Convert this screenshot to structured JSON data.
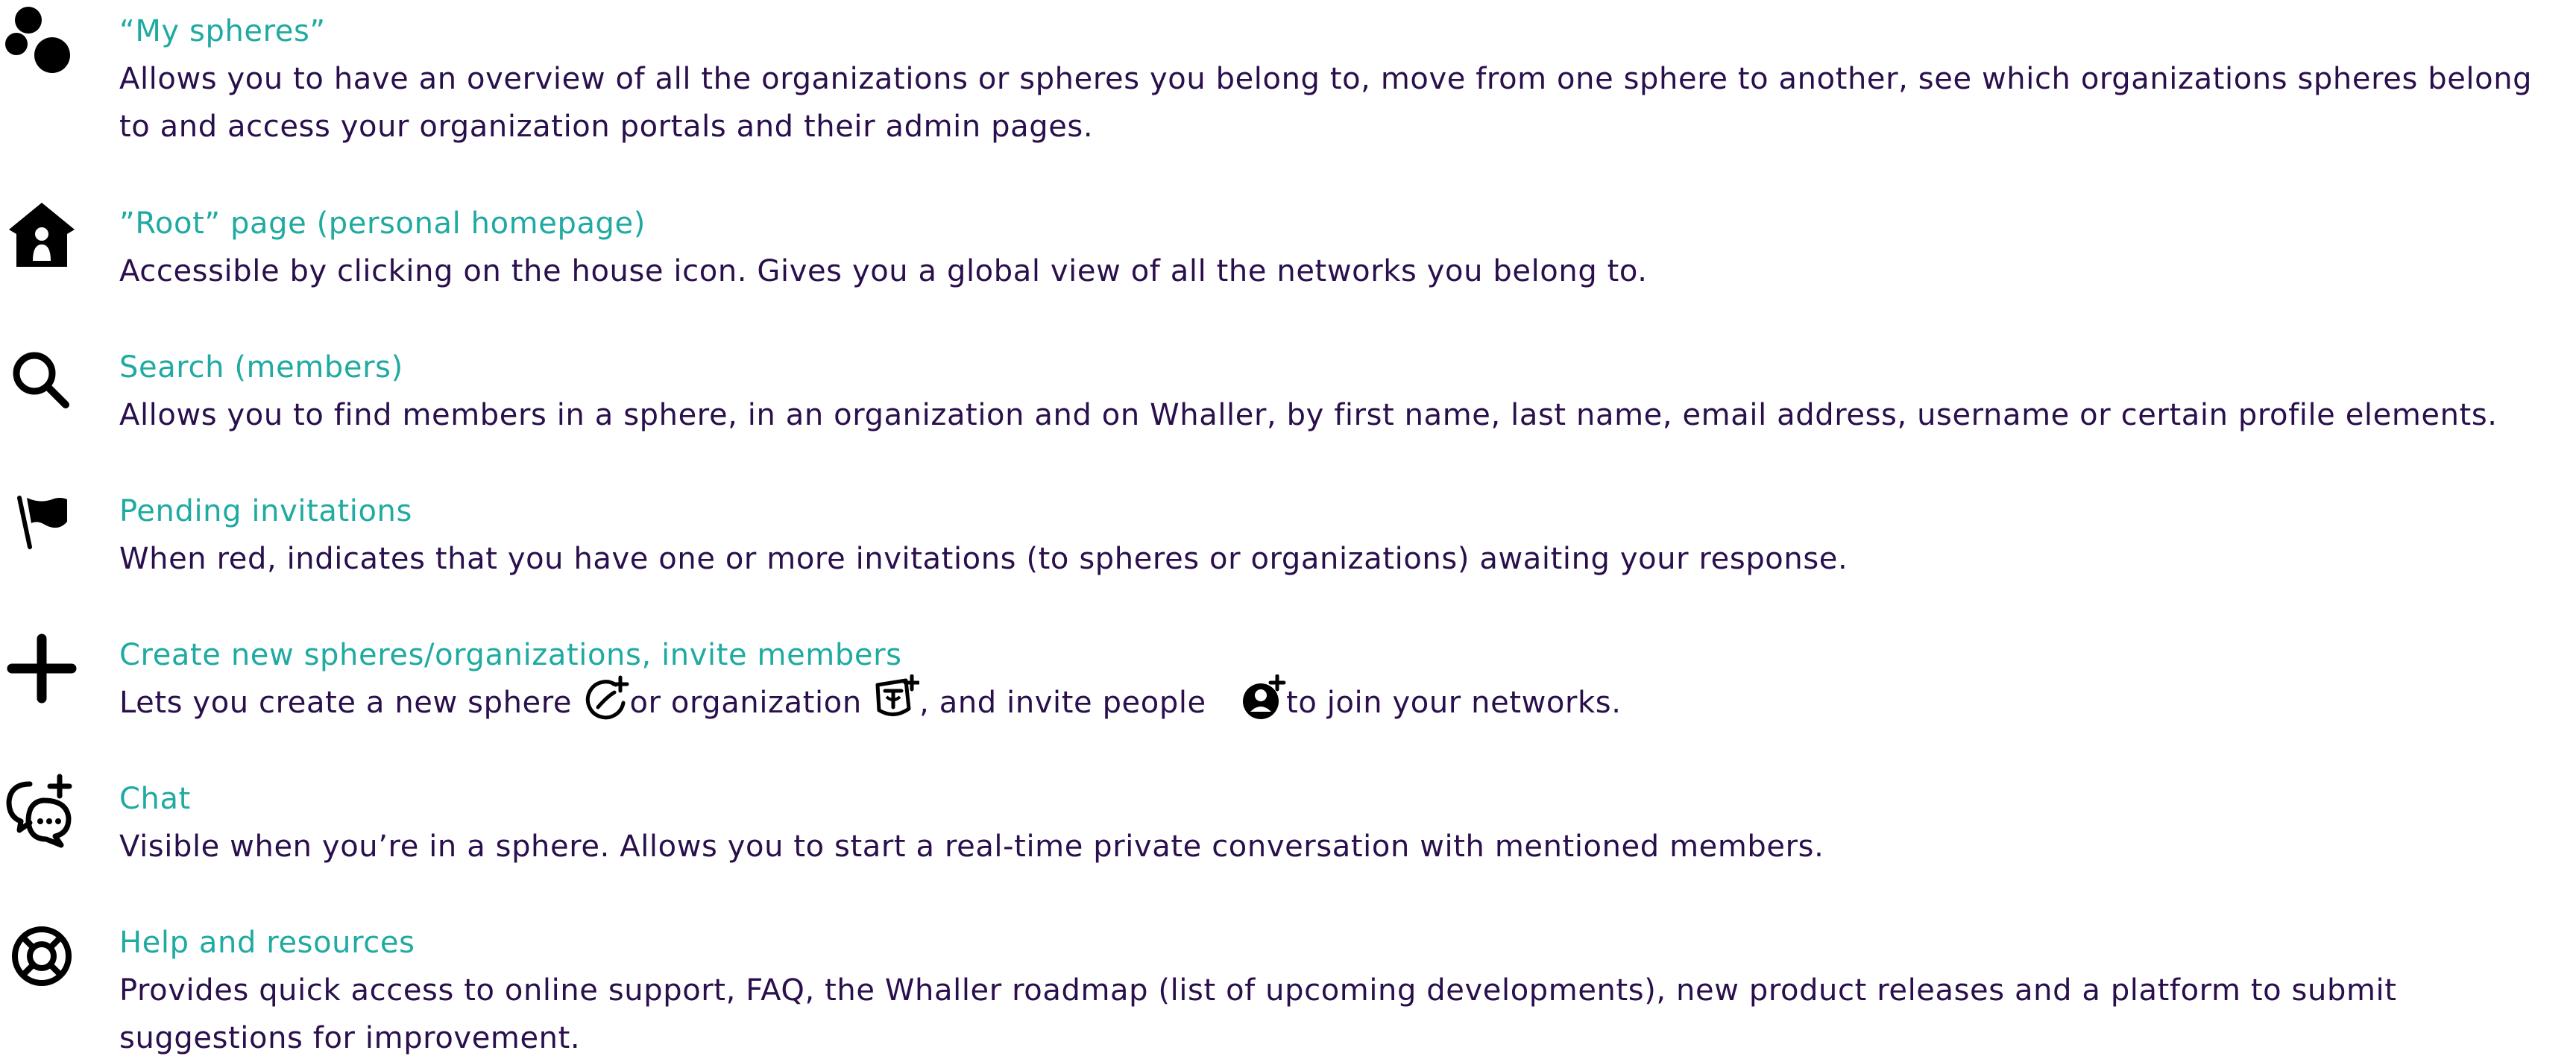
{
  "items": [
    {
      "icon": "spheres-icon",
      "title": "“My spheres”",
      "desc_line1": "Allows you to have an overview of all the organizations or spheres you belong to, move from one sphere to another, see which organizations spheres belong",
      "desc_line2": "to and access your organization portals and their admin pages."
    },
    {
      "icon": "house-icon",
      "title": "”Root” page (personal homepage)",
      "desc": "Accessible by clicking on the house icon. Gives you a global view of all the networks you belong to."
    },
    {
      "icon": "search-icon",
      "title": "Search (members)",
      "desc": "Allows you to find members in a sphere, in an organization and on Whaller, by first name, last name, email address, username or certain profile elements."
    },
    {
      "icon": "flag-icon",
      "title": "Pending invitations",
      "desc": "When red, indicates that you have one or more invitations (to spheres or organizations) awaiting your response."
    },
    {
      "icon": "plus-icon",
      "title": "Create new spheres/organizations, invite members",
      "desc_part1": "Lets you create a new sphere ",
      "desc_part2": "or organization ",
      "desc_part3": ", and invite people ",
      "desc_part4": "to join your networks."
    },
    {
      "icon": "chat-plus-icon",
      "title": "Chat",
      "desc": "Visible when you’re in a sphere. Allows you to start a real-time private conversation with mentioned members."
    },
    {
      "icon": "lifebuoy-icon",
      "title": "Help and resources",
      "desc_line1": "Provides quick access to online support, FAQ, the Whaller roadmap (list of upcoming developments), new product releases and a platform to submit",
      "desc_line2": "suggestions for improvement."
    }
  ],
  "colors": {
    "title": "#1faaa2",
    "text": "#2a0f4d",
    "icon": "#000000"
  }
}
